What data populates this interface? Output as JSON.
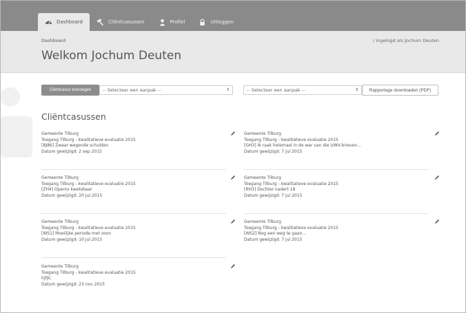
{
  "nav": {
    "items": [
      {
        "label": "Dashboard",
        "icon": "dashboard-icon",
        "active": true
      },
      {
        "label": "Cliëntcasussen",
        "icon": "hammer-icon"
      },
      {
        "label": "Profiel",
        "icon": "user-icon"
      },
      {
        "label": "Uitloggen",
        "icon": "lock-icon"
      }
    ]
  },
  "header": {
    "breadcrumb": "Dashboard",
    "logged_in": "/  Ingelogd als Jochum Deuten",
    "welcome": "Welkom Jochum Deuten"
  },
  "toolbar": {
    "add_button": "Cliëntcasus toevoegen",
    "select_left": "-- Selecteer een aanpak --",
    "select_right": "-- Selecteer een aanpak --",
    "pdf_button": "Rapportage downloaden (PDF)"
  },
  "section": {
    "title": "Cliëntcasussen"
  },
  "cases": [
    {
      "org": "Gemeente Tilburg",
      "project": "Toegang Tilburg - kwalitatieve evaluatie 2015",
      "title": "[BJ86] Zwaar wegende schulden",
      "date": "Datum gewijzigd: 2 sep 2015"
    },
    {
      "org": "Gemeente Tilburg",
      "project": "Toegang Tilburg - kwalitatieve evaluatie 2015",
      "title": "[GH3] Ik raak helemaal in de war van die UWV-brieven...",
      "date": "Datum gewijzigd: 7 jul 2015"
    },
    {
      "org": "Gemeente Tilburg",
      "project": "Toegang Tilburg - kwalitatieve evaluatie 2015",
      "title": "[ZH4] Operns kwetsbaar",
      "date": "Datum gewijzigd: 20 jul 2015"
    },
    {
      "org": "Gemeente Tilburg",
      "project": "Toegang Tilburg - kwalitatieve evaluatie 2015",
      "title": "[RH3] Dochter nadert 18",
      "date": "Datum gewijzigd: 7 jul 2015"
    },
    {
      "org": "Gemeente Tilburg",
      "project": "Toegang Tilburg - kwalitatieve evaluatie 2015",
      "title": "[WS1] Moeilijke periode met zoon",
      "date": "Datum gewijzigd: 10 jul 2015"
    },
    {
      "org": "Gemeente Tilburg",
      "project": "Toegang Tilburg - kwalitatieve evaluatie 2015",
      "title": "[WS2] Nog een weg te gaan...",
      "date": "Datum gewijzigd: 7 jul 2015"
    },
    {
      "org": "Gemeente Tilburg",
      "project": "Toegang Tilburg - kwalitatieve evaluatie 2015",
      "title": "hjfjk;",
      "date": "Datum gewijzigd: 23 nov 2015"
    }
  ]
}
